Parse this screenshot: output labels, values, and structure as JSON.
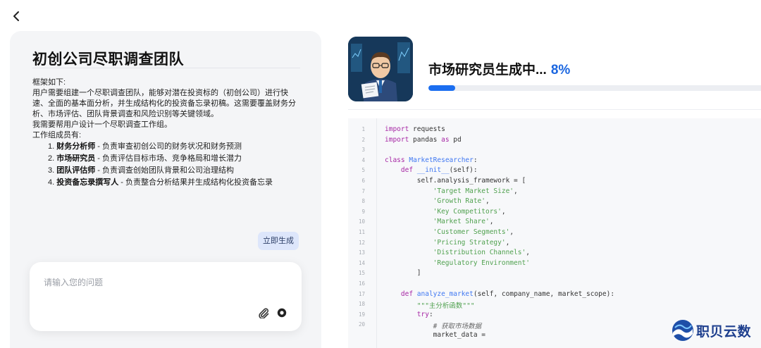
{
  "header": {
    "back_icon": "chevron-left-icon"
  },
  "team": {
    "title": "初创公司尽职调查团队",
    "framework_label": "框架如下:",
    "paragraph1": "用户需要组建一个尽职调查团队，能够对潜在投资标的（初创公司）进行快速、全面的基本面分析，并生成结构化的投资备忘录初稿。这需要覆盖财务分析、市场评估、团队背景调查和风险识别等关键领域。",
    "paragraph2": "我需要帮用户设计一个尽职调查工作组。",
    "members_label": "工作组成员有:",
    "members": [
      {
        "num": "1.",
        "name": "财务分析师",
        "desc": " - 负责审查初创公司的财务状况和财务预测"
      },
      {
        "num": "2.",
        "name": "市场研究员",
        "desc": " - 负责评估目标市场、竞争格局和增长潜力"
      },
      {
        "num": "3.",
        "name": "团队评估师",
        "desc": " - 负责调查创始团队背景和公司治理结构"
      },
      {
        "num": "4.",
        "name": "投资备忘录撰写人",
        "desc": " - 负责整合分析结果并生成结构化投资备忘录"
      }
    ]
  },
  "actions": {
    "generate_label": "立即生成"
  },
  "input": {
    "placeholder": "请输入您的问题",
    "value": "",
    "attach_icon": "paperclip-icon",
    "record_icon": "record-icon"
  },
  "progress": {
    "status_label": "市场研究员生成中...",
    "percent_label": "8%",
    "fraction": 0.08
  },
  "code": {
    "lines": [
      {
        "n": "1",
        "html": "<span class=\"kw\">import</span> requests"
      },
      {
        "n": "2",
        "html": "<span class=\"kw\">import</span> pandas <span class=\"kw\">as</span> pd"
      },
      {
        "n": "3",
        "html": ""
      },
      {
        "n": "4",
        "html": "<span class=\"kw\">class</span> <span class=\"cls\">MarketResearcher</span>:"
      },
      {
        "n": "5",
        "html": "    <span class=\"kw\">def</span> <span class=\"fn\">__init__</span>(self):"
      },
      {
        "n": "6",
        "html": "        self.analysis_framework = ["
      },
      {
        "n": "7",
        "html": "            <span class=\"str\">'Target Market Size'</span>,"
      },
      {
        "n": "8",
        "html": "            <span class=\"str\">'Growth Rate'</span>,"
      },
      {
        "n": "9",
        "html": "            <span class=\"str\">'Key Competitors'</span>,"
      },
      {
        "n": "10",
        "html": "            <span class=\"str\">'Market Share'</span>,"
      },
      {
        "n": "11",
        "html": "            <span class=\"str\">'Customer Segments'</span>,"
      },
      {
        "n": "12",
        "html": "            <span class=\"str\">'Pricing Strategy'</span>,"
      },
      {
        "n": "13",
        "html": "            <span class=\"str\">'Distribution Channels'</span>,"
      },
      {
        "n": "14",
        "html": "            <span class=\"str\">'Regulatory Environment'</span>"
      },
      {
        "n": "15",
        "html": "        ]"
      },
      {
        "n": "16",
        "html": ""
      },
      {
        "n": "17",
        "html": "    <span class=\"kw\">def</span> <span class=\"fn\">analyze_market</span>(self, company_name, market_scope):"
      },
      {
        "n": "18",
        "html": "        <span class=\"str\">\"\"\"主分析函数\"\"\"</span>"
      },
      {
        "n": "19",
        "html": "        <span class=\"kw\">try</span>:"
      },
      {
        "n": "20",
        "html": "            <span class=\"cm\"># 获取市场数据</span>"
      },
      {
        "n": "",
        "html": "            market_data ="
      }
    ]
  },
  "brand": {
    "name": "职贝云数"
  },
  "colors": {
    "accent": "#1b66e0",
    "progress_fill": "#1b6ef0",
    "button_bg": "#dde6fb",
    "brand": "#1e3f8e"
  }
}
